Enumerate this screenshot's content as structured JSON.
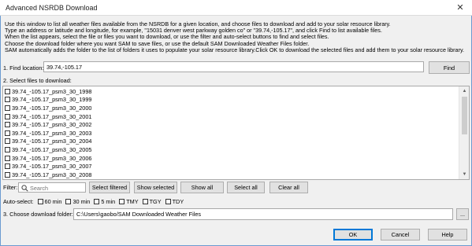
{
  "window": {
    "title": "Advanced NSRDB Download",
    "close_glyph": "✕"
  },
  "intro": [
    "Use this window to list all weather files available from the NSRDB for a given location, and choose files to download and add to your solar resource library.",
    "  Type an address or latitude and longitude, for example, \"15031 denver west parkway golden co\" or \"39.74,-105.17\", and click Find to list available files.",
    "When the list appears, select the file or files you want to download, or use the filter and auto-select buttons to find and select files.",
    "Choose the download folder where you want SAM to save files, or use the default SAM Downloaded Weather Files folder.",
    "  SAM automatically adds the folder to the list of folders it uses to populate your solar resource library.Click OK to download the selected files and add them to your solar resource library."
  ],
  "find": {
    "label": "1. Find location:",
    "value": "39.74,-105.17",
    "button": "Find"
  },
  "files": {
    "label": "2. Select files to download:",
    "items": [
      "39.74_-105.17_psm3_30_1998",
      "39.74_-105.17_psm3_30_1999",
      "39.74_-105.17_psm3_30_2000",
      "39.74_-105.17_psm3_30_2001",
      "39.74_-105.17_psm3_30_2002",
      "39.74_-105.17_psm3_30_2003",
      "39.74_-105.17_psm3_30_2004",
      "39.74_-105.17_psm3_30_2005",
      "39.74_-105.17_psm3_30_2006",
      "39.74_-105.17_psm3_30_2007",
      "39.74_-105.17_psm3_30_2008"
    ]
  },
  "filter": {
    "label": "Filter:",
    "placeholder": "Search",
    "buttons": {
      "select_filtered": "Select filtered",
      "show_selected": "Show selected",
      "show_all": "Show all",
      "select_all": "Select all",
      "clear_all": "Clear all"
    }
  },
  "autoselect": {
    "label": "Auto-select:",
    "options": [
      "60 min",
      "30 min",
      "5 min",
      "TMY",
      "TGY",
      "TDY"
    ]
  },
  "folder": {
    "label": "3. Choose download folder:",
    "value": "C:\\Users\\gaobo/SAM Downloaded Weather Files",
    "browse": "..."
  },
  "footer": {
    "ok": "OK",
    "cancel": "Cancel",
    "help": "Help"
  },
  "colors": {
    "accent": "#0078d7",
    "frame": "#6b9bd1"
  }
}
